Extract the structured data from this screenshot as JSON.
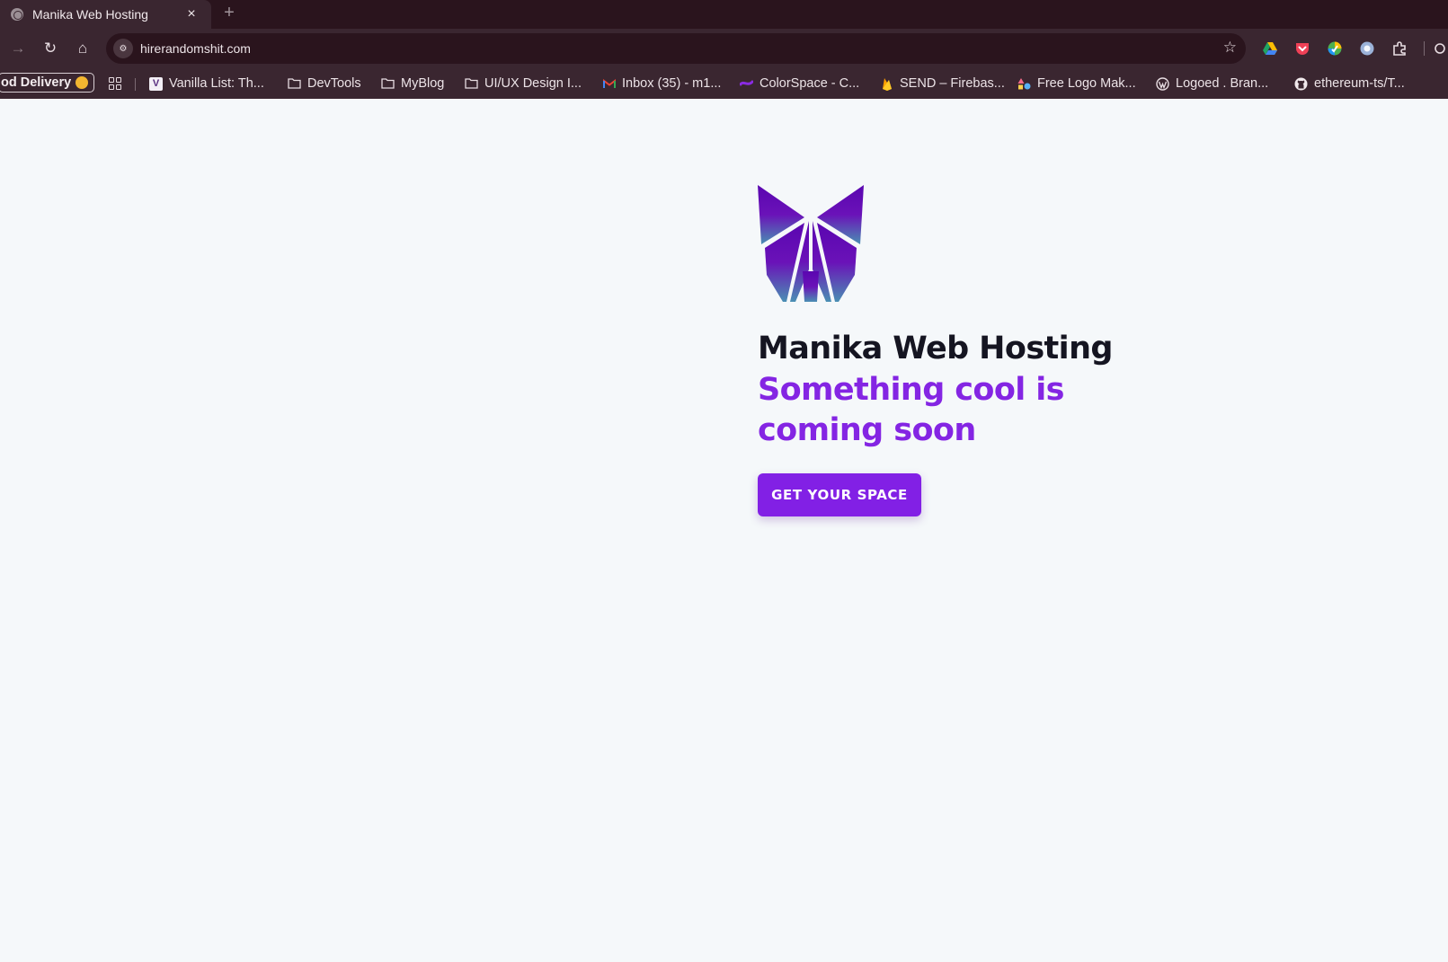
{
  "browser": {
    "tab": {
      "title": "Manika Web Hosting",
      "close_glyph": "×",
      "favicon": "globe-icon"
    },
    "new_tab_glyph": "+",
    "toolbar": {
      "back_glyph": "→",
      "reload_glyph": "↻",
      "home_glyph": "⌂",
      "url": "hirerandomshit.com",
      "site_info_glyph": "⚙",
      "bookmark_star_glyph": "☆"
    },
    "bookmarks": [
      {
        "label": "od Delivery",
        "icon": "burger-emoji-icon"
      },
      {
        "label": "Vanilla List: Th...",
        "icon": "vanilla-list-icon"
      },
      {
        "label": "DevTools",
        "icon": "folder-icon"
      },
      {
        "label": "MyBlog",
        "icon": "folder-icon"
      },
      {
        "label": "UI/UX Design I...",
        "icon": "folder-icon"
      },
      {
        "label": "Inbox (35) - m1...",
        "icon": "gmail-icon"
      },
      {
        "label": "ColorSpace - C...",
        "icon": "colorspace-icon"
      },
      {
        "label": "SEND – Firebas...",
        "icon": "firebase-icon"
      },
      {
        "label": "Free Logo Mak...",
        "icon": "logo-maker-icon"
      },
      {
        "label": "Logoed . Bran...",
        "icon": "wordpress-icon"
      },
      {
        "label": "ethereum-ts/T...",
        "icon": "github-icon"
      }
    ]
  },
  "page": {
    "heading": "Manika Web Hosting",
    "tagline": "Something cool is coming soon",
    "cta_label": "GET YOUR SPACE",
    "colors": {
      "accent": "#8220e5",
      "tagline": "#8425e3",
      "heading": "#151521",
      "background": "#f5f8fa"
    }
  }
}
